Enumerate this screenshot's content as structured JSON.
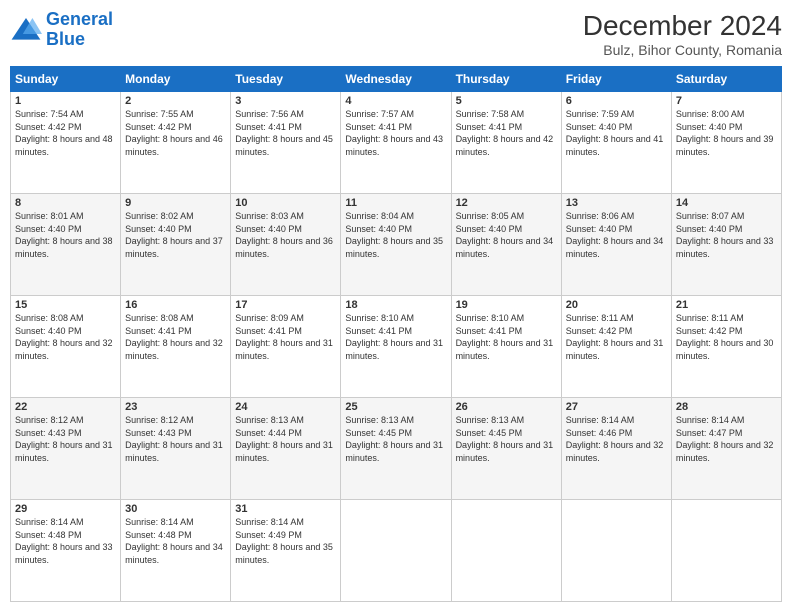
{
  "logo": {
    "text_general": "General",
    "text_blue": "Blue"
  },
  "header": {
    "title": "December 2024",
    "subtitle": "Bulz, Bihor County, Romania"
  },
  "weekdays": [
    "Sunday",
    "Monday",
    "Tuesday",
    "Wednesday",
    "Thursday",
    "Friday",
    "Saturday"
  ],
  "weeks": [
    [
      {
        "day": "1",
        "sunrise": "7:54 AM",
        "sunset": "4:42 PM",
        "daylight": "8 hours and 48 minutes."
      },
      {
        "day": "2",
        "sunrise": "7:55 AM",
        "sunset": "4:42 PM",
        "daylight": "8 hours and 46 minutes."
      },
      {
        "day": "3",
        "sunrise": "7:56 AM",
        "sunset": "4:41 PM",
        "daylight": "8 hours and 45 minutes."
      },
      {
        "day": "4",
        "sunrise": "7:57 AM",
        "sunset": "4:41 PM",
        "daylight": "8 hours and 43 minutes."
      },
      {
        "day": "5",
        "sunrise": "7:58 AM",
        "sunset": "4:41 PM",
        "daylight": "8 hours and 42 minutes."
      },
      {
        "day": "6",
        "sunrise": "7:59 AM",
        "sunset": "4:40 PM",
        "daylight": "8 hours and 41 minutes."
      },
      {
        "day": "7",
        "sunrise": "8:00 AM",
        "sunset": "4:40 PM",
        "daylight": "8 hours and 39 minutes."
      }
    ],
    [
      {
        "day": "8",
        "sunrise": "8:01 AM",
        "sunset": "4:40 PM",
        "daylight": "8 hours and 38 minutes."
      },
      {
        "day": "9",
        "sunrise": "8:02 AM",
        "sunset": "4:40 PM",
        "daylight": "8 hours and 37 minutes."
      },
      {
        "day": "10",
        "sunrise": "8:03 AM",
        "sunset": "4:40 PM",
        "daylight": "8 hours and 36 minutes."
      },
      {
        "day": "11",
        "sunrise": "8:04 AM",
        "sunset": "4:40 PM",
        "daylight": "8 hours and 35 minutes."
      },
      {
        "day": "12",
        "sunrise": "8:05 AM",
        "sunset": "4:40 PM",
        "daylight": "8 hours and 34 minutes."
      },
      {
        "day": "13",
        "sunrise": "8:06 AM",
        "sunset": "4:40 PM",
        "daylight": "8 hours and 34 minutes."
      },
      {
        "day": "14",
        "sunrise": "8:07 AM",
        "sunset": "4:40 PM",
        "daylight": "8 hours and 33 minutes."
      }
    ],
    [
      {
        "day": "15",
        "sunrise": "8:08 AM",
        "sunset": "4:40 PM",
        "daylight": "8 hours and 32 minutes."
      },
      {
        "day": "16",
        "sunrise": "8:08 AM",
        "sunset": "4:41 PM",
        "daylight": "8 hours and 32 minutes."
      },
      {
        "day": "17",
        "sunrise": "8:09 AM",
        "sunset": "4:41 PM",
        "daylight": "8 hours and 31 minutes."
      },
      {
        "day": "18",
        "sunrise": "8:10 AM",
        "sunset": "4:41 PM",
        "daylight": "8 hours and 31 minutes."
      },
      {
        "day": "19",
        "sunrise": "8:10 AM",
        "sunset": "4:41 PM",
        "daylight": "8 hours and 31 minutes."
      },
      {
        "day": "20",
        "sunrise": "8:11 AM",
        "sunset": "4:42 PM",
        "daylight": "8 hours and 31 minutes."
      },
      {
        "day": "21",
        "sunrise": "8:11 AM",
        "sunset": "4:42 PM",
        "daylight": "8 hours and 30 minutes."
      }
    ],
    [
      {
        "day": "22",
        "sunrise": "8:12 AM",
        "sunset": "4:43 PM",
        "daylight": "8 hours and 31 minutes."
      },
      {
        "day": "23",
        "sunrise": "8:12 AM",
        "sunset": "4:43 PM",
        "daylight": "8 hours and 31 minutes."
      },
      {
        "day": "24",
        "sunrise": "8:13 AM",
        "sunset": "4:44 PM",
        "daylight": "8 hours and 31 minutes."
      },
      {
        "day": "25",
        "sunrise": "8:13 AM",
        "sunset": "4:45 PM",
        "daylight": "8 hours and 31 minutes."
      },
      {
        "day": "26",
        "sunrise": "8:13 AM",
        "sunset": "4:45 PM",
        "daylight": "8 hours and 31 minutes."
      },
      {
        "day": "27",
        "sunrise": "8:14 AM",
        "sunset": "4:46 PM",
        "daylight": "8 hours and 32 minutes."
      },
      {
        "day": "28",
        "sunrise": "8:14 AM",
        "sunset": "4:47 PM",
        "daylight": "8 hours and 32 minutes."
      }
    ],
    [
      {
        "day": "29",
        "sunrise": "8:14 AM",
        "sunset": "4:48 PM",
        "daylight": "8 hours and 33 minutes."
      },
      {
        "day": "30",
        "sunrise": "8:14 AM",
        "sunset": "4:48 PM",
        "daylight": "8 hours and 34 minutes."
      },
      {
        "day": "31",
        "sunrise": "8:14 AM",
        "sunset": "4:49 PM",
        "daylight": "8 hours and 35 minutes."
      },
      null,
      null,
      null,
      null
    ]
  ],
  "labels": {
    "sunrise": "Sunrise: ",
    "sunset": "Sunset: ",
    "daylight": "Daylight: "
  }
}
